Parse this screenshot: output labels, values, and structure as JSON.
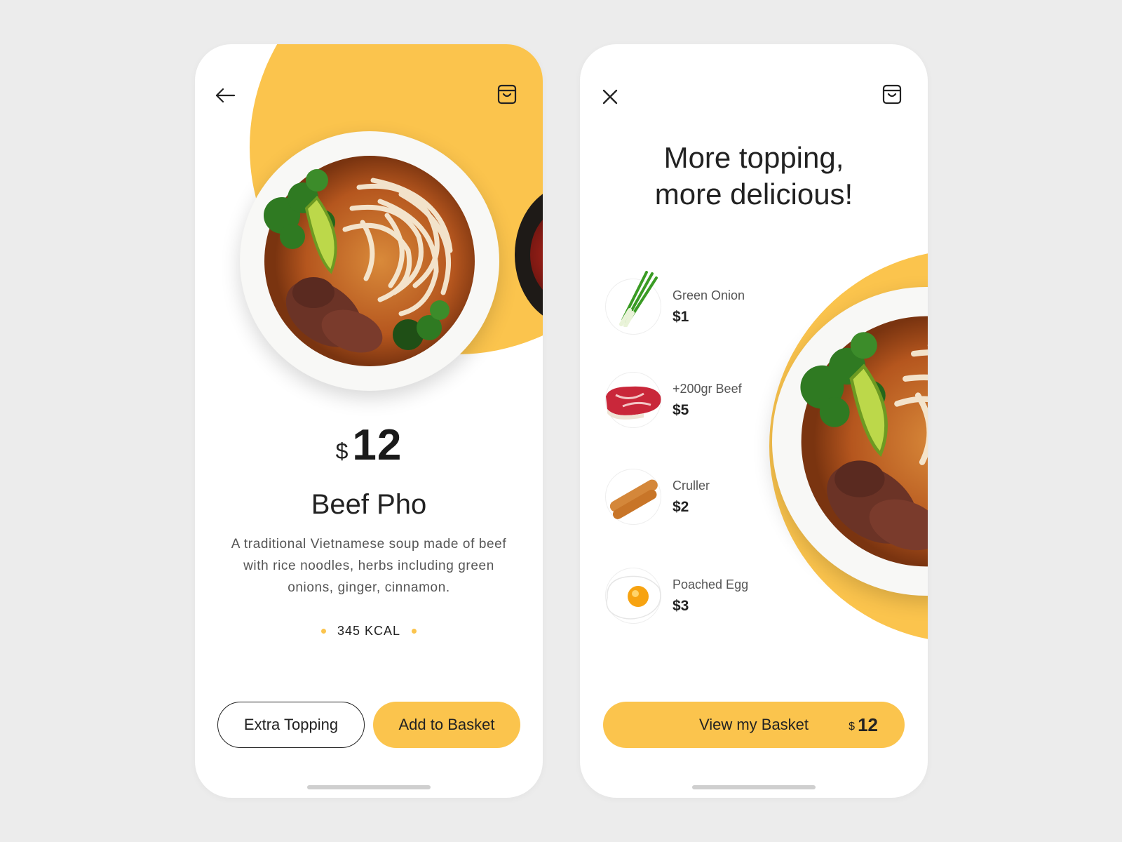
{
  "colors": {
    "accent": "#fbc44d",
    "background": "#ececec",
    "text": "#222222"
  },
  "detail_screen": {
    "back_icon": "arrow-left-icon",
    "cart_icon": "shopping-bag-icon",
    "currency": "$",
    "price": "12",
    "title": "Beef Pho",
    "description": "A traditional Vietnamese soup made of beef with rice noodles, herbs including green onions, ginger, cinnamon.",
    "calories": "345 KCAL",
    "extra_topping_label": "Extra Topping",
    "add_to_basket_label": "Add to Basket"
  },
  "topping_screen": {
    "close_icon": "close-icon",
    "cart_icon": "shopping-bag-icon",
    "headline_line1": "More topping,",
    "headline_line2": "more delicious!",
    "toppings": [
      {
        "name": "Green Onion",
        "price": "$1"
      },
      {
        "name": "+200gr Beef",
        "price": "$5"
      },
      {
        "name": "Cruller",
        "price": "$2"
      },
      {
        "name": "Poached Egg",
        "price": "$3"
      }
    ],
    "basket_label": "View my Basket",
    "basket_currency": "$",
    "basket_price": "12"
  }
}
